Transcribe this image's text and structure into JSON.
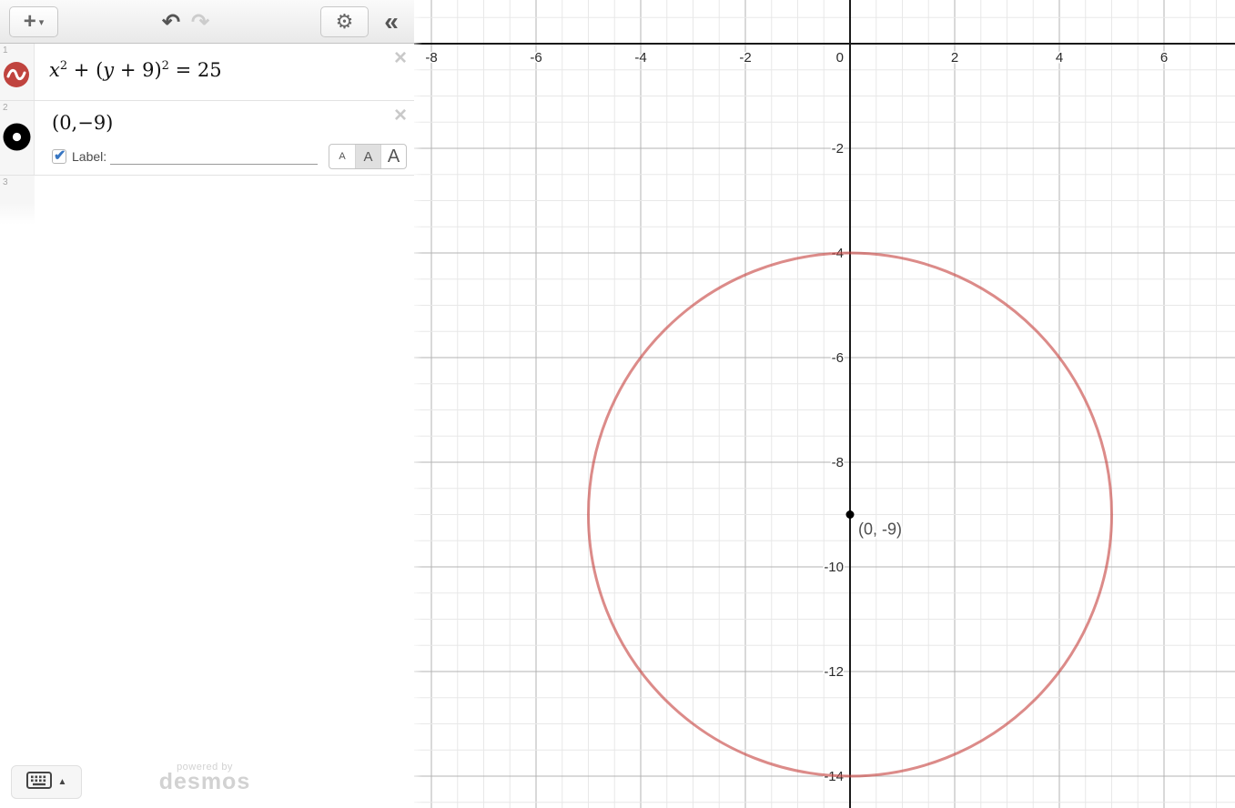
{
  "toolbar": {
    "add_label": "+",
    "add_caret": "▾",
    "undo_icon": "↶",
    "redo_icon": "↷",
    "settings_icon": "⚙",
    "collapse_icon": "«"
  },
  "expressions": [
    {
      "index": "1",
      "type": "equation",
      "latex": "x^2+(y+9)^2=25",
      "color": "#c74440",
      "close_icon": "×"
    },
    {
      "index": "2",
      "type": "point",
      "text": "(0,−9)",
      "close_icon": "×",
      "label_checkbox_checked": true,
      "check_icon": "✔",
      "label_text": "Label:",
      "label_value": "",
      "size_options": [
        "A",
        "A",
        "A"
      ],
      "selected_size": 1
    },
    {
      "index": "3",
      "type": "empty"
    }
  ],
  "footer": {
    "keyboard_icon": "keyboard",
    "keyboard_caret": "▲",
    "watermark_line1": "powered by",
    "watermark_line2": "desmos"
  },
  "chart_data": {
    "type": "line",
    "title": "",
    "grid": true,
    "axes": {
      "x_visible_range": [
        -8.45,
        7.36
      ],
      "y_visible_range": [
        -14.6,
        0.84
      ],
      "minor_step": 0.5,
      "major_step": 2,
      "x_tick_labels": [
        -8,
        -6,
        -4,
        -2,
        0,
        2,
        4,
        6
      ],
      "y_tick_labels": [
        -2,
        -4,
        -6,
        -8,
        -10,
        -12,
        -14
      ]
    },
    "equations": [
      {
        "latex": "x^2+(y+9)^2=25",
        "shape": "circle",
        "center": [
          0,
          -9
        ],
        "radius": 5,
        "color": "#c74440",
        "opacity": 0.62
      }
    ],
    "points": [
      {
        "x": 0,
        "y": -9,
        "label": "(0, -9)",
        "color": "#000000"
      }
    ]
  }
}
